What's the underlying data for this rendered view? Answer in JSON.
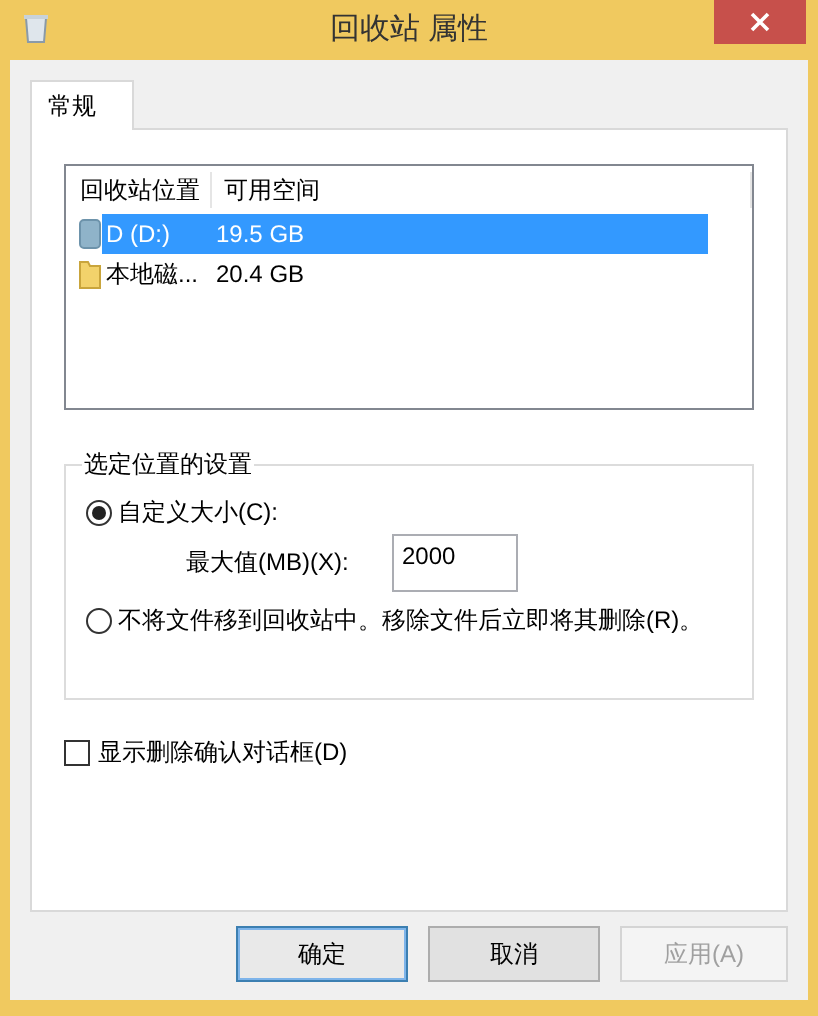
{
  "window": {
    "title": "回收站 属性"
  },
  "tabs": [
    {
      "label": "常规",
      "selected": true
    }
  ],
  "list": {
    "columns": [
      "回收站位置",
      "可用空间"
    ],
    "rows": [
      {
        "kind": "drive",
        "name": "D (D:)",
        "space": "19.5 GB",
        "selected": true
      },
      {
        "kind": "folder",
        "name": "本地磁...",
        "space": "20.4 GB",
        "selected": false
      }
    ]
  },
  "settings": {
    "title": "选定位置的设置",
    "options": [
      {
        "label": "自定义大小(C):",
        "selected": true
      },
      {
        "label": "不将文件移到回收站中。移除文件后立即将其删除(R)。",
        "selected": false
      }
    ],
    "max_size": {
      "label": "最大值(MB)(X):",
      "value": "2000"
    }
  },
  "confirm": {
    "label": "显示删除确认对话框(D)",
    "checked": false
  },
  "buttons": [
    {
      "label": "确定",
      "disabled": false,
      "default": true
    },
    {
      "label": "取消",
      "disabled": false,
      "default": false
    },
    {
      "label": "应用(A)",
      "disabled": true,
      "default": false
    }
  ]
}
